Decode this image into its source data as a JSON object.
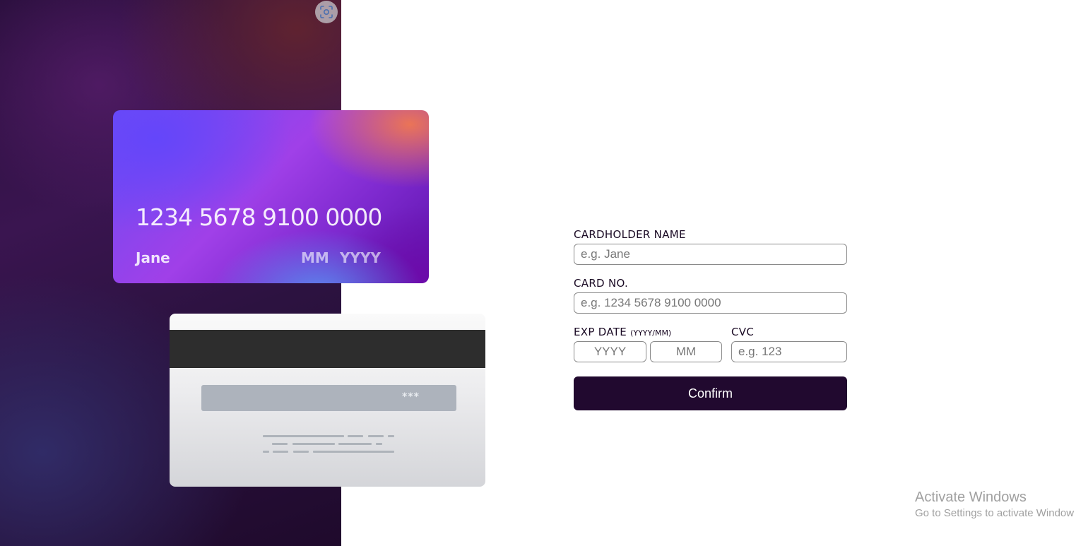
{
  "card_front": {
    "number": "1234 5678 9100 0000",
    "name": "Jane",
    "month": "MM",
    "year": "YYYY"
  },
  "card_back": {
    "cvc": "***"
  },
  "form": {
    "cardholder_label": "CARDHOLDER NAME",
    "cardholder_placeholder": "e.g. Jane",
    "card_no_label": "CARD NO.",
    "card_no_placeholder": "e.g. 1234 5678 9100 0000",
    "exp_label": "EXP DATE",
    "exp_hint": "(YYYY/MM)",
    "year_placeholder": "YYYY",
    "month_placeholder": "MM",
    "cvc_label": "CVC",
    "cvc_placeholder": "e.g. 123",
    "confirm_label": "Confirm"
  },
  "watermark": {
    "title": "Activate Windows",
    "subtitle": "Go to Settings to activate Window"
  },
  "icons": {
    "scan": "scan-icon"
  },
  "colors": {
    "button": "#21092f",
    "panel_dark": "#21092f"
  }
}
